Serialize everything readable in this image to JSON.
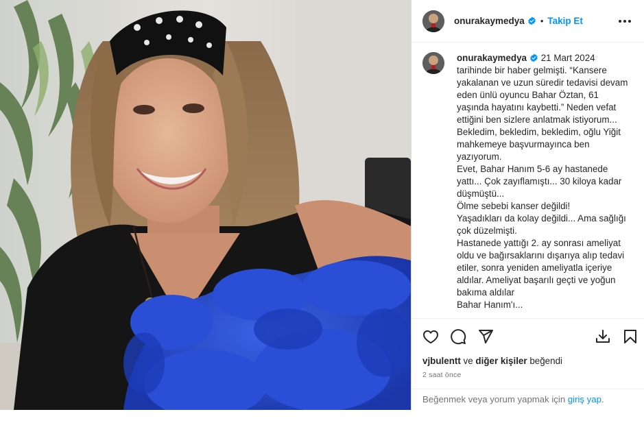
{
  "header": {
    "username": "onurakaymedya",
    "separator": "•",
    "follow_label": "Takip Et"
  },
  "caption": {
    "username": "onurakaymedya",
    "date": "21 Mart 2024",
    "first_line_rest": "tarihinde bir haber gelmişti. “Kansere yakalanan ve uzun süredir tedavisi devam eden ünlü oyuncu Bahar Öztan, 61 yaşında hayatını kaybetti.” Neden vefat ettiğini ben sizlere anlatmak istiyorum...",
    "paragraphs": [
      "Bekledim, bekledim, bekledim, oğlu Yiğit mahkemeye başvurmayınca ben yazıyorum.",
      "Evet, Bahar Hanım 5-6 ay hastanede yattı... Çok zayıflamıştı... 30 kiloya kadar düşmüştü...",
      "Ölme sebebi kanser değildi!",
      "Yaşadıkları da kolay değildi... Ama sağlığı çok düzelmişti.",
      "Hastanede yattığı 2. ay sonrası ameliyat oldu ve bağırsaklarını dışarıya alıp tedavi etiler, sonra yeniden ameliyatla içeriye aldılar. Ameliyat başarılı geçti ve yoğun bakıma aldılar",
      "Bahar Hanım'ı..."
    ]
  },
  "likes": {
    "user": "vjbulentt",
    "connector": "ve",
    "others": "diğer kişiler",
    "suffix": "beğendi"
  },
  "timestamp": "2 saat önce",
  "login_bar": {
    "text": "Beğenmek veya yorum yapmak için",
    "link": "giriş yap",
    "end": "."
  },
  "icons": {
    "verified": "verified-badge-icon",
    "more": "more-options-icon",
    "like": "heart-icon",
    "comment": "comment-icon",
    "share": "share-icon",
    "download": "download-icon",
    "save": "bookmark-icon"
  },
  "colors": {
    "accent": "#0095f6",
    "text": "#262626",
    "muted": "#737373",
    "border": "#dbdbdb",
    "feather_blue": "#2346c8"
  }
}
